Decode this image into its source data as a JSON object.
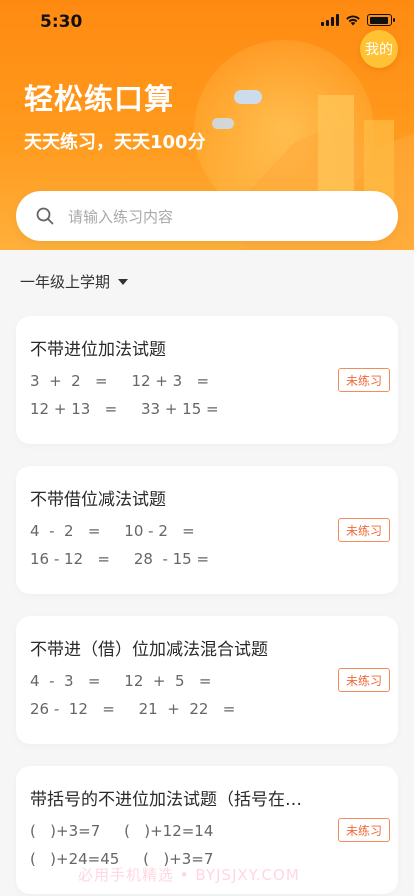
{
  "status": {
    "time": "5:30"
  },
  "header": {
    "me_label": "我的",
    "title": "轻松练口算",
    "subtitle": "天天练习，天天100分"
  },
  "search": {
    "placeholder": "请输入练习内容"
  },
  "grade": {
    "label": "一年级上学期"
  },
  "cards": [
    {
      "title": "不带进位加法试题",
      "row1": "3  +  2   =     12 + 3   =",
      "row2": "12 + 13   =     33 + 15 =",
      "badge": "未练习"
    },
    {
      "title": "不带借位减法试题",
      "row1": "4  -  2   =     10 - 2   =",
      "row2": "16 - 12   =     28  - 15 =",
      "badge": "未练习"
    },
    {
      "title": "不带进（借）位加减法混合试题",
      "row1": "4  -  3   =     12  +  5   =",
      "row2": "26 -  12   =     21  +  22   =",
      "badge": "未练习"
    },
    {
      "title": "带括号的不进位加法试题（括号在…",
      "row1": "(   )+3=7     (   )+12=14",
      "row2": "(   )+24=45     (   )+3=7",
      "badge": "未练习"
    }
  ],
  "watermark": "必用手机精选 • BYJSJXY.COM",
  "colors": {
    "brand_orange": "#ff8a12",
    "badge": "#f06a3a",
    "me_button": "#ffc235"
  }
}
